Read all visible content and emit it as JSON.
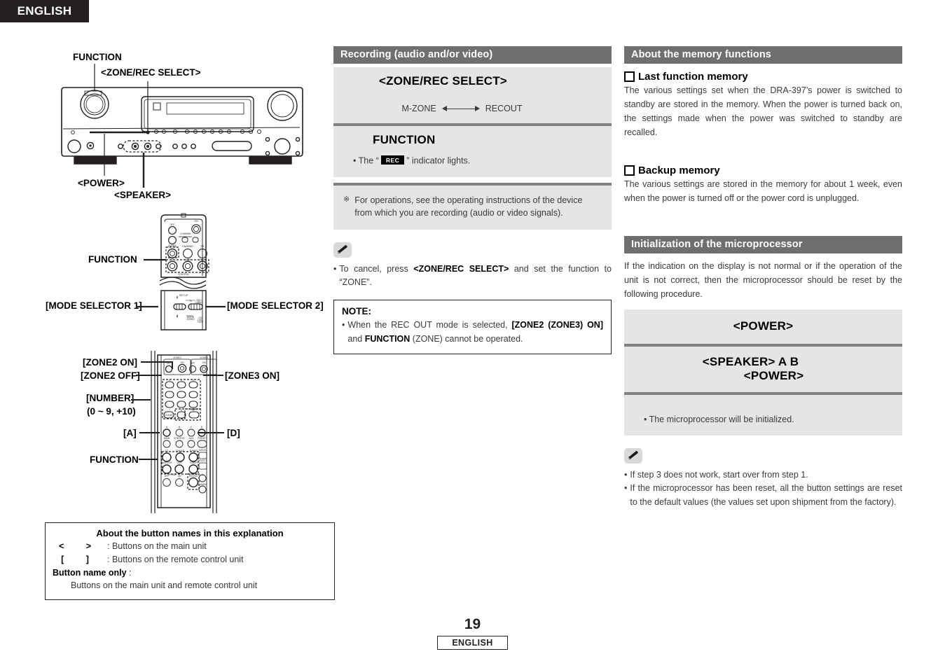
{
  "language_tab": "ENGLISH",
  "figures": {
    "main_unit": {
      "callouts": {
        "function": "FUNCTION",
        "zone_rec_select": "<ZONE/REC SELECT>",
        "power": "<POWER>",
        "speaker": "<SPEAKER>"
      }
    },
    "remote_top": {
      "callouts": {
        "function": "FUNCTION",
        "mode_selector_1": "[MODE SELECTOR 1]",
        "mode_selector_2": "[MODE SELECTOR 2]"
      }
    },
    "remote_bottom": {
      "callouts": {
        "zone2_on": "[ZONE2 ON]",
        "zone2_off": "[ZONE2 OFF]",
        "zone3_on": "[ZONE3 ON]",
        "number": "[NUMBER]",
        "number_range": "(0 ~ 9, +10)",
        "a": "[A]",
        "d": "[D]",
        "function": "FUNCTION"
      }
    }
  },
  "legend": {
    "title": "About the button names in this explanation",
    "rows": [
      {
        "key": "<   >",
        "desc": ": Buttons on the main unit"
      },
      {
        "key": "[    ]",
        "desc": ": Buttons on the remote control unit"
      }
    ],
    "bold_row_key": "Button name only",
    "bold_row_colon": ":",
    "bold_row_desc": "Buttons on the main unit and remote control unit"
  },
  "recording": {
    "header": "Recording (audio and/or video)",
    "steps": [
      {
        "title": "<ZONE/REC  SELECT>",
        "arrow_left": "M-ZONE",
        "arrow_right": "RECOUT"
      },
      {
        "title": "FUNCTION",
        "note_prefix": "• The “",
        "note_chip": "REC",
        "note_suffix": "” indicator lights."
      }
    ],
    "asterisk_mark": "※",
    "asterisk_text": "For operations, see the operating instructions of the device from which you are recording (audio or video signals).",
    "memo": {
      "bullet": "•",
      "part1": "To cancel, press ",
      "bold": "<ZONE/REC SELECT>",
      "part2": " and set the function to “ZONE”."
    },
    "note": {
      "title": "NOTE:",
      "bullet": "•",
      "part1": "When the REC OUT mode is selected, ",
      "bold1": "[ZONE2 (ZONE3) ON]",
      "part2": " and ",
      "bold2": "FUNCTION",
      "part3": " (ZONE) cannot be operated."
    }
  },
  "memory": {
    "header": "About the memory functions",
    "last_function_title": "Last function memory",
    "last_function_body": "The various settings set when the DRA-397’s power is switched to standby are stored in the memory. When the power is turned back on, the settings made when the power was switched to standby are recalled.",
    "backup_title": "Backup memory",
    "backup_body": "The various settings are stored in the memory for about 1 week, even when the power is turned off or the power cord is unplugged."
  },
  "initialization": {
    "header": "Initialization of the microprocessor",
    "intro": "If the indication on the display is not normal or if the operation of the unit is not correct, then the microprocessor should be reset by the following procedure.",
    "steps": [
      {
        "title": "<POWER>"
      },
      {
        "title_line1": "<SPEAKER>  A       B",
        "title_line2": "<POWER>"
      },
      {
        "note": "• The microprocessor will be initialized."
      }
    ],
    "memo": [
      {
        "bullet": "•",
        "text": "If step 3 does not work, start over from step 1."
      },
      {
        "bullet": "•",
        "text": "If the microprocessor has been reset, all the button settings are reset to the default values (the values set upon shipment from the factory)."
      }
    ]
  },
  "footer": {
    "page_number": "19",
    "language": "ENGLISH"
  },
  "colors": {
    "header_bar": "#6f6f6f",
    "step_bg": "#e5e5e5",
    "divider": "#808080",
    "ink": "#231f20"
  }
}
